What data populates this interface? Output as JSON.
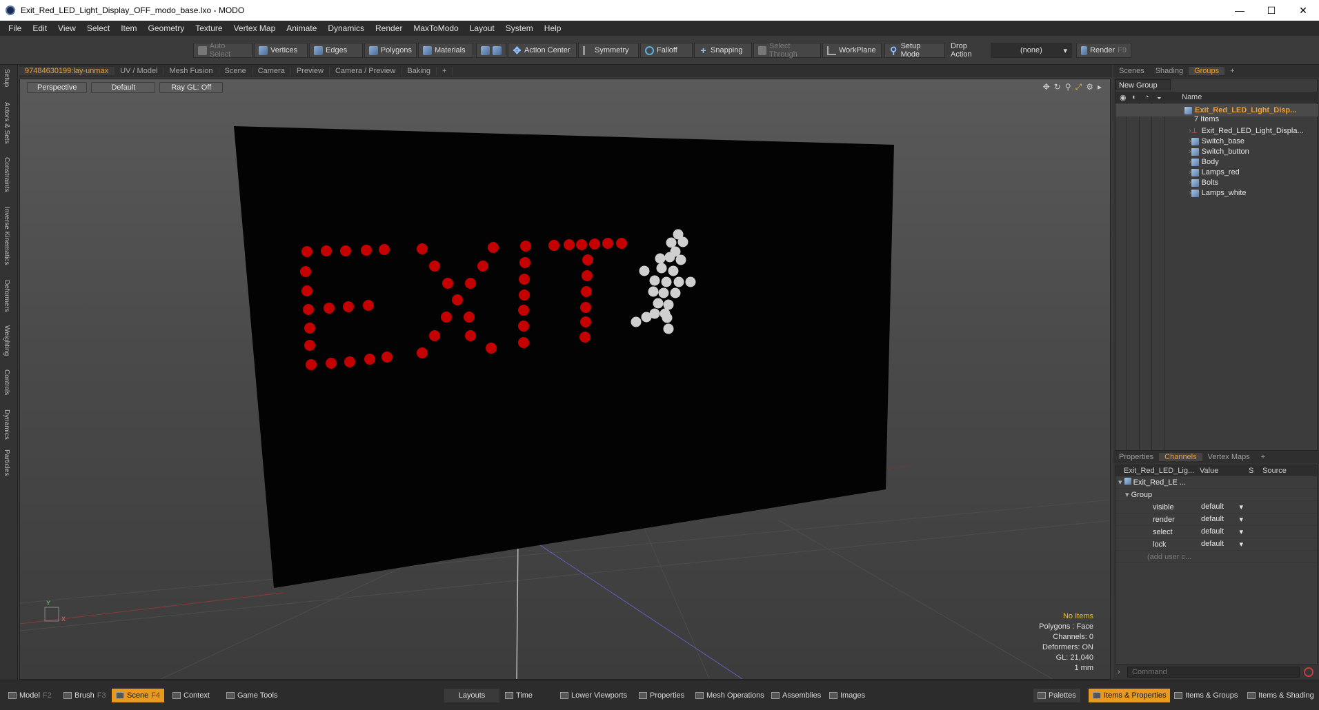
{
  "window": {
    "title": "Exit_Red_LED_Light_Display_OFF_modo_base.lxo - MODO",
    "minimize": "—",
    "maximize": "☐",
    "close": "✕"
  },
  "menu": [
    "File",
    "Edit",
    "View",
    "Select",
    "Item",
    "Geometry",
    "Texture",
    "Vertex Map",
    "Animate",
    "Dynamics",
    "Render",
    "MaxToModo",
    "Layout",
    "System",
    "Help"
  ],
  "toolbar": {
    "auto_select": "Auto Select",
    "vertices": "Vertices",
    "edges": "Edges",
    "polygons": "Polygons",
    "materials": "Materials",
    "action_center": "Action Center",
    "symmetry": "Symmetry",
    "falloff": "Falloff",
    "snapping": "Snapping",
    "select_through": "Select Through",
    "workplane": "WorkPlane",
    "setup_mode": "Setup Mode",
    "drop_action": "Drop Action",
    "drop_value": "(none)",
    "render": "Render",
    "render_key": "F9"
  },
  "left_tabs": [
    "Setup",
    "Actors & Sets",
    "Constraints",
    "Inverse Kinematics",
    "Deformers",
    "Weighting",
    "Controls",
    "Dynamics",
    "Particles"
  ],
  "viewport_tabs": [
    "97484630199:lay-unmax",
    "UV / Model",
    "Mesh Fusion",
    "Scene",
    "Camera",
    "Preview",
    "Camera / Preview",
    "Baking",
    "+"
  ],
  "viewport": {
    "view": "Perspective",
    "shading": "Default",
    "raygl": "Ray GL: Off"
  },
  "scene_text": {
    "letters": "EXIT"
  },
  "info": {
    "items": "No Items",
    "polygons": "Polygons : Face",
    "channels": "Channels: 0",
    "deformers": "Deformers: ON",
    "gl": "GL: 21,040",
    "unit": "1 mm"
  },
  "right_tabs": [
    "Scenes",
    "Shading",
    "Groups",
    "+"
  ],
  "groups": {
    "new_group": "New Group",
    "col_name": "Name",
    "root": "Exit_Red_LED_Light_Disp...",
    "root_count": "7 Items",
    "items": [
      "Exit_Red_LED_Light_Displa...",
      "Switch_base",
      "Switch_button",
      "Body",
      "Lamps_red",
      "Bolts",
      "Lamps_white"
    ]
  },
  "channels_tabs": [
    "Properties",
    "Channels",
    "Vertex Maps",
    "+"
  ],
  "channels": {
    "col_item": "Exit_Red_LED_Lig...",
    "col_value": "Value",
    "col_s": "S",
    "col_source": "Source",
    "root": "Exit_Red_LE ...",
    "group": "Group",
    "rows": [
      {
        "name": "visible",
        "value": "default"
      },
      {
        "name": "render",
        "value": "default"
      },
      {
        "name": "select",
        "value": "default"
      },
      {
        "name": "lock",
        "value": "default"
      }
    ],
    "add_user": "(add user c..."
  },
  "command_placeholder": "Command",
  "statusbar": {
    "model": "Model",
    "model_key": "F2",
    "brush": "Brush",
    "brush_key": "F3",
    "scene": "Scene",
    "scene_key": "F4",
    "context": "Context",
    "game_tools": "Game Tools",
    "layouts": "Layouts",
    "time": "Time",
    "lower_viewports": "Lower Viewports",
    "properties": "Properties",
    "mesh_operations": "Mesh Operations",
    "assemblies": "Assemblies",
    "images": "Images",
    "palettes": "Palettes",
    "items_properties": "Items & Properties",
    "items_groups": "Items & Groups",
    "items_shading": "Items & Shading"
  }
}
